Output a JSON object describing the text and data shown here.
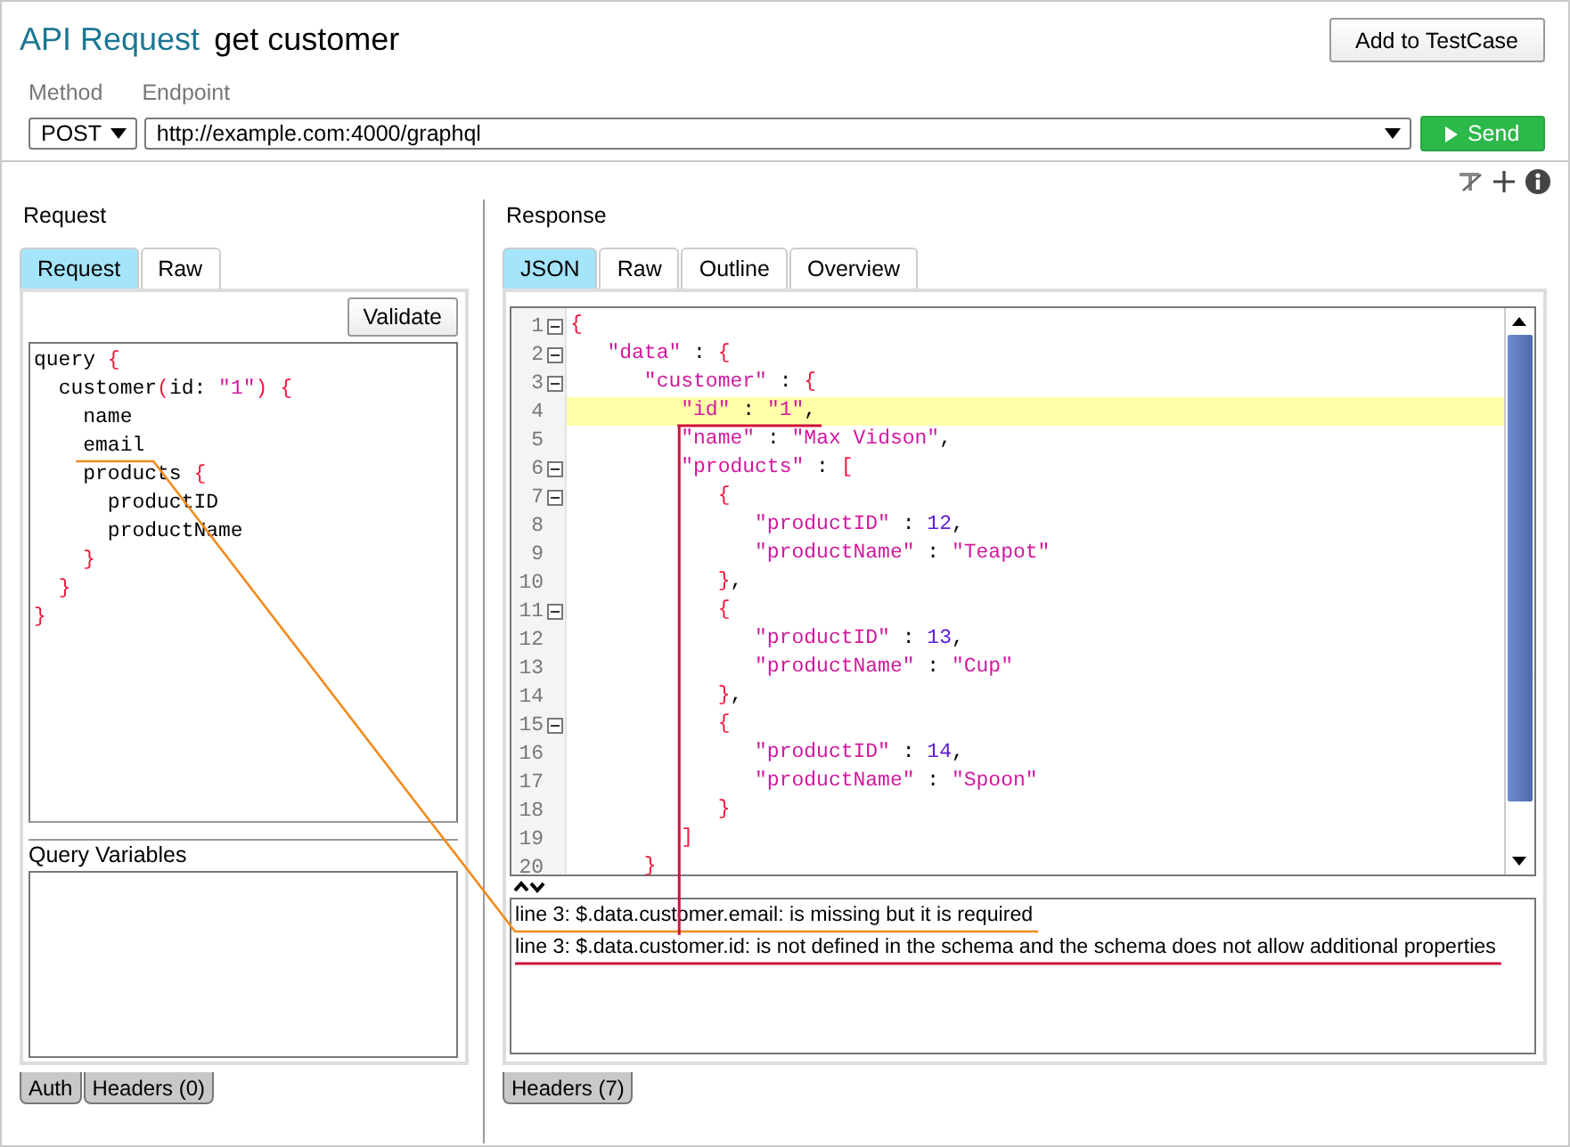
{
  "header": {
    "title_prefix": "API Request",
    "title": "get customer",
    "add_button": "Add to TestCase"
  },
  "request_line": {
    "method_label": "Method",
    "endpoint_label": "Endpoint",
    "method": "POST",
    "endpoint": "http://example.com:4000/graphql",
    "send_button": "Send"
  },
  "request": {
    "heading": "Request",
    "tabs": [
      {
        "label": "Request",
        "selected": true
      },
      {
        "label": "Raw",
        "selected": false
      }
    ],
    "validate_button": "Validate",
    "code": [
      [
        {
          "text": "query ",
          "kind": "plain"
        },
        {
          "text": "{",
          "kind": "brace"
        }
      ],
      [
        {
          "text": "  customer",
          "kind": "plain"
        },
        {
          "text": "(",
          "kind": "brace"
        },
        {
          "text": "id: ",
          "kind": "plain"
        },
        {
          "text": "\"1\"",
          "kind": "string"
        },
        {
          "text": ") {",
          "kind": "brace"
        }
      ],
      [
        {
          "text": "    name",
          "kind": "plain"
        }
      ],
      [
        {
          "text": "    email",
          "kind": "plain"
        }
      ],
      [
        {
          "text": "    products ",
          "kind": "plain"
        },
        {
          "text": "{",
          "kind": "brace"
        }
      ],
      [
        {
          "text": "      productID",
          "kind": "plain"
        }
      ],
      [
        {
          "text": "      productName",
          "kind": "plain"
        }
      ],
      [
        {
          "text": "    }",
          "kind": "brace"
        }
      ],
      [
        {
          "text": "  }",
          "kind": "brace"
        }
      ],
      [
        {
          "text": "}",
          "kind": "brace"
        }
      ]
    ],
    "variables_label": "Query Variables",
    "bottom_tabs": [
      {
        "label": "Auth",
        "selected": false
      },
      {
        "label": "Headers (0)",
        "selected": false
      }
    ]
  },
  "response": {
    "heading": "Response",
    "tabs": [
      {
        "label": "JSON",
        "selected": true
      },
      {
        "label": "Raw",
        "selected": false
      },
      {
        "label": "Outline",
        "selected": false
      },
      {
        "label": "Overview",
        "selected": false
      }
    ],
    "lines": [
      {
        "number": "1",
        "foldable": true,
        "highlighted": false,
        "tokens": [
          {
            "text": "{",
            "kind": "brace"
          }
        ]
      },
      {
        "number": "2",
        "foldable": true,
        "highlighted": false,
        "tokens": [
          {
            "text": "   \"data\"",
            "kind": "key"
          },
          {
            "text": " : ",
            "kind": "punct"
          },
          {
            "text": "{",
            "kind": "brace"
          }
        ]
      },
      {
        "number": "3",
        "foldable": true,
        "highlighted": false,
        "tokens": [
          {
            "text": "      \"customer\"",
            "kind": "key"
          },
          {
            "text": " : ",
            "kind": "punct"
          },
          {
            "text": "{",
            "kind": "brace"
          }
        ]
      },
      {
        "number": "4",
        "foldable": false,
        "highlighted": true,
        "tokens": [
          {
            "text": "         \"id\"",
            "kind": "key"
          },
          {
            "text": " : ",
            "kind": "punct"
          },
          {
            "text": "\"1\"",
            "kind": "string"
          },
          {
            "text": ",",
            "kind": "punct"
          }
        ]
      },
      {
        "number": "5",
        "foldable": false,
        "highlighted": false,
        "tokens": [
          {
            "text": "         \"name\"",
            "kind": "key"
          },
          {
            "text": " : ",
            "kind": "punct"
          },
          {
            "text": "\"Max Vidson\"",
            "kind": "string"
          },
          {
            "text": ",",
            "kind": "punct"
          }
        ]
      },
      {
        "number": "6",
        "foldable": true,
        "highlighted": false,
        "tokens": [
          {
            "text": "         \"products\"",
            "kind": "key"
          },
          {
            "text": " : ",
            "kind": "punct"
          },
          {
            "text": "[",
            "kind": "brace"
          }
        ]
      },
      {
        "number": "7",
        "foldable": true,
        "highlighted": false,
        "tokens": [
          {
            "text": "            {",
            "kind": "brace"
          }
        ]
      },
      {
        "number": "8",
        "foldable": false,
        "highlighted": false,
        "tokens": [
          {
            "text": "               \"productID\"",
            "kind": "key"
          },
          {
            "text": " : ",
            "kind": "punct"
          },
          {
            "text": "12",
            "kind": "number"
          },
          {
            "text": ",",
            "kind": "punct"
          }
        ]
      },
      {
        "number": "9",
        "foldable": false,
        "highlighted": false,
        "tokens": [
          {
            "text": "               \"productName\"",
            "kind": "key"
          },
          {
            "text": " : ",
            "kind": "punct"
          },
          {
            "text": "\"Teapot\"",
            "kind": "string"
          }
        ]
      },
      {
        "number": "10",
        "foldable": false,
        "highlighted": false,
        "tokens": [
          {
            "text": "            }",
            "kind": "brace"
          },
          {
            "text": ",",
            "kind": "punct"
          }
        ]
      },
      {
        "number": "11",
        "foldable": true,
        "highlighted": false,
        "tokens": [
          {
            "text": "            {",
            "kind": "brace"
          }
        ]
      },
      {
        "number": "12",
        "foldable": false,
        "highlighted": false,
        "tokens": [
          {
            "text": "               \"productID\"",
            "kind": "key"
          },
          {
            "text": " : ",
            "kind": "punct"
          },
          {
            "text": "13",
            "kind": "number"
          },
          {
            "text": ",",
            "kind": "punct"
          }
        ]
      },
      {
        "number": "13",
        "foldable": false,
        "highlighted": false,
        "tokens": [
          {
            "text": "               \"productName\"",
            "kind": "key"
          },
          {
            "text": " : ",
            "kind": "punct"
          },
          {
            "text": "\"Cup\"",
            "kind": "string"
          }
        ]
      },
      {
        "number": "14",
        "foldable": false,
        "highlighted": false,
        "tokens": [
          {
            "text": "            }",
            "kind": "brace"
          },
          {
            "text": ",",
            "kind": "punct"
          }
        ]
      },
      {
        "number": "15",
        "foldable": true,
        "highlighted": false,
        "tokens": [
          {
            "text": "            {",
            "kind": "brace"
          }
        ]
      },
      {
        "number": "16",
        "foldable": false,
        "highlighted": false,
        "tokens": [
          {
            "text": "               \"productID\"",
            "kind": "key"
          },
          {
            "text": " : ",
            "kind": "punct"
          },
          {
            "text": "14",
            "kind": "number"
          },
          {
            "text": ",",
            "kind": "punct"
          }
        ]
      },
      {
        "number": "17",
        "foldable": false,
        "highlighted": false,
        "tokens": [
          {
            "text": "               \"productName\"",
            "kind": "key"
          },
          {
            "text": " : ",
            "kind": "punct"
          },
          {
            "text": "\"Spoon\"",
            "kind": "string"
          }
        ]
      },
      {
        "number": "18",
        "foldable": false,
        "highlighted": false,
        "tokens": [
          {
            "text": "            }",
            "kind": "brace"
          }
        ]
      },
      {
        "number": "19",
        "foldable": false,
        "highlighted": false,
        "tokens": [
          {
            "text": "         ]",
            "kind": "brace"
          }
        ]
      },
      {
        "number": "20",
        "foldable": false,
        "highlighted": false,
        "tokens": [
          {
            "text": "      }",
            "kind": "brace"
          }
        ]
      }
    ],
    "messages": [
      {
        "text": "line 3: $.data.customer.email: is missing but it is required",
        "color": "#f28a1c"
      },
      {
        "text": "line 3: $.data.customer.id: is not defined in the schema and the schema does not allow additional properties",
        "color": "#d0103a"
      }
    ],
    "bottom_tabs": [
      {
        "label": "Headers (7)",
        "selected": false
      }
    ]
  }
}
